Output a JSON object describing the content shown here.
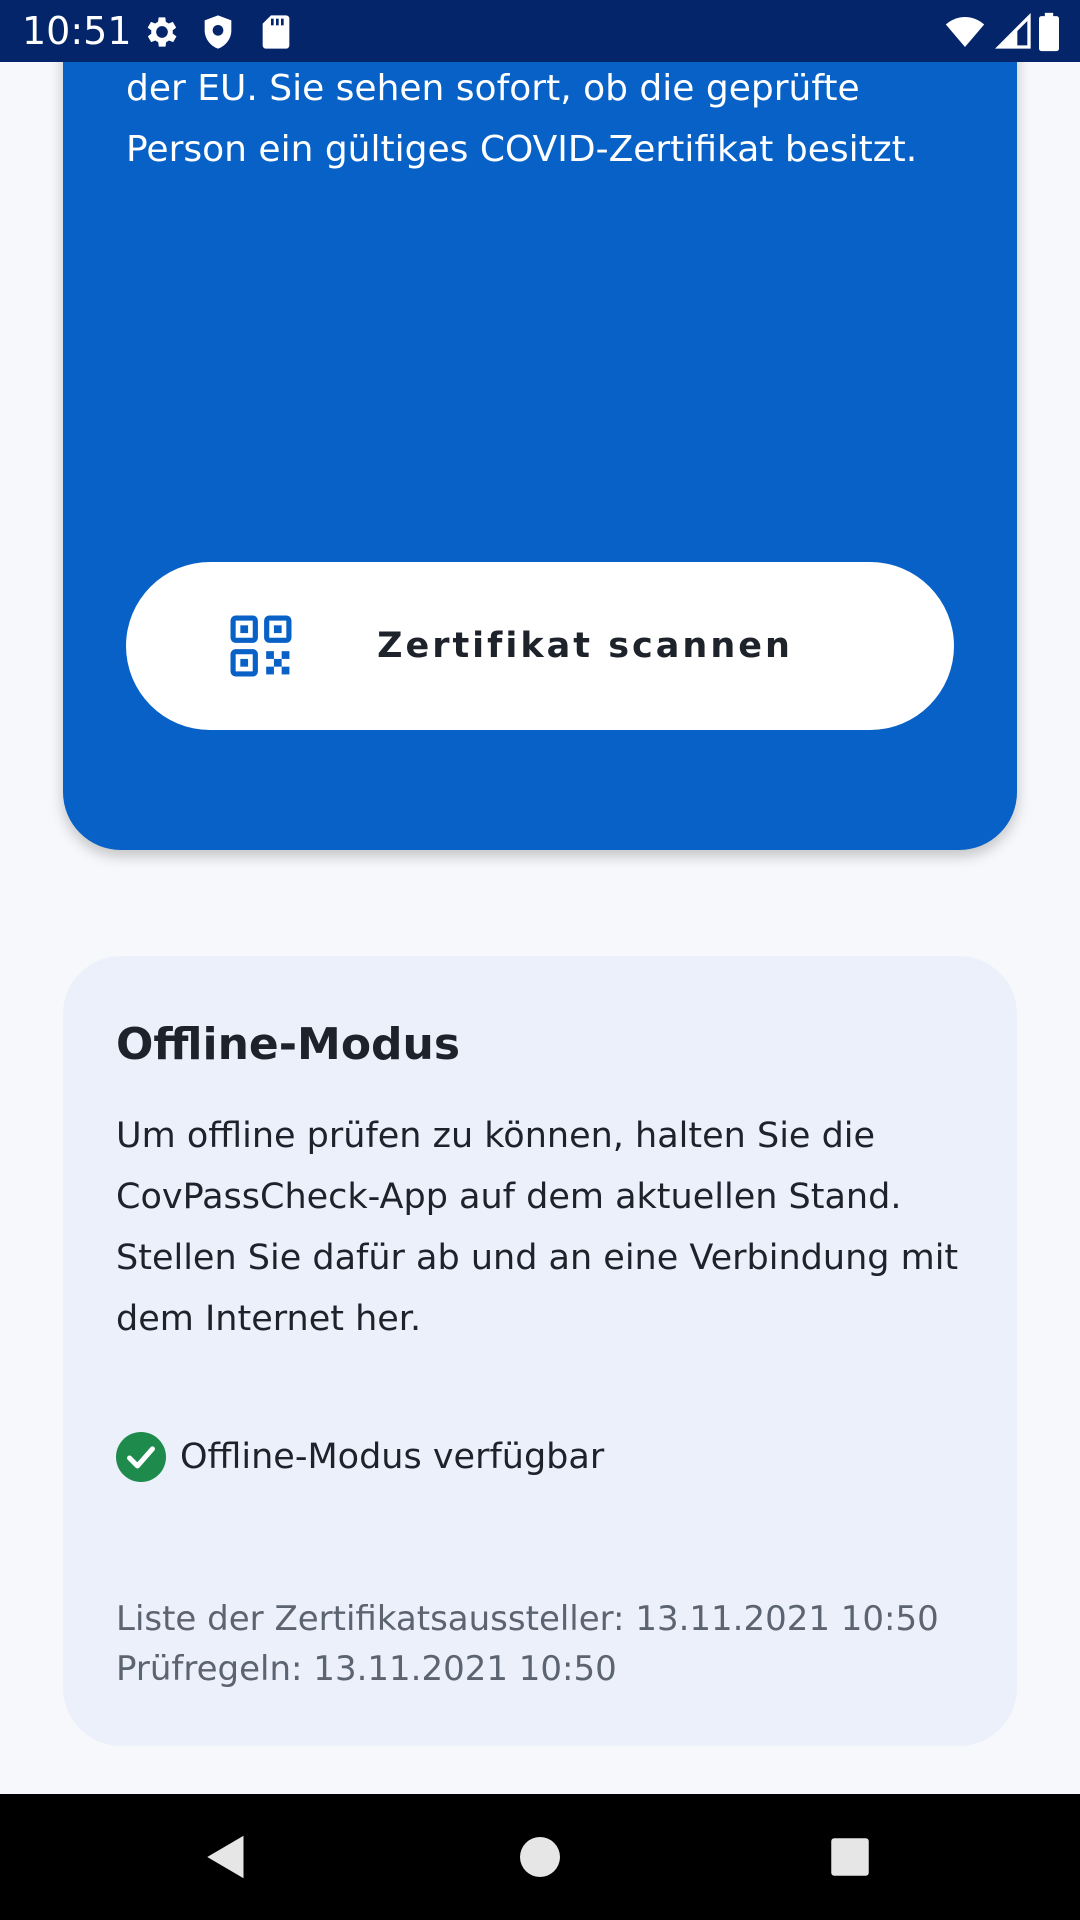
{
  "status_bar": {
    "time": "10:51",
    "left_icons": [
      "gear-icon",
      "shield-icon",
      "sd-card-icon"
    ],
    "right_icons": [
      "wifi-icon",
      "cell-signal-icon",
      "battery-icon"
    ],
    "background": "#04256a"
  },
  "hero_card": {
    "text_lines": [
      "der EU. Sie sehen sofort, ob die geprüfte",
      "Person ein gültiges COVID-Zertifikat besitzt."
    ],
    "scan_button_label": "Zertifikat scannen",
    "scan_button_icon": "qr-code-icon",
    "background": "#0761c7"
  },
  "offline_card": {
    "title": "Offline-Modus",
    "description_lines": [
      "Um offline prüfen zu können, halten Sie die",
      "CovPassCheck-App auf dem aktuellen Stand.",
      "Stellen Sie dafür ab und an eine Verbindung mit",
      "dem Internet her."
    ],
    "status_icon": "check-circle-icon",
    "status_text": "Offline-Modus verfügbar",
    "issuer_list_line": "Liste der Zertifikatsaussteller: 13.11.2021 10:50",
    "rules_line": "Prüfregeln: 13.11.2021 10:50",
    "background": "#ebf0fb",
    "status_color": "#1e8a4c"
  },
  "nav_bar": {
    "buttons": [
      "back-icon",
      "home-icon",
      "recents-icon"
    ]
  }
}
